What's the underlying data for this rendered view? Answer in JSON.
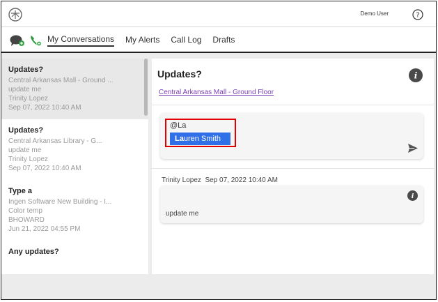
{
  "header": {
    "user_name": "Demo User"
  },
  "nav": {
    "tabs": [
      {
        "label": "My Conversations",
        "active": true
      },
      {
        "label": "My Alerts",
        "active": false
      },
      {
        "label": "Call Log",
        "active": false
      },
      {
        "label": "Drafts",
        "active": false
      }
    ]
  },
  "conversations": [
    {
      "title": "Updates?",
      "location": "Central Arkansas Mall - Ground ...",
      "message": "update me",
      "author": "Trinity Lopez",
      "date": "Sep 07, 2022 10:40 AM",
      "selected": true
    },
    {
      "title": "Updates?",
      "location": "Central Arkansas Library - G...",
      "message": "update me",
      "author": "Trinity Lopez",
      "date": "Sep 07, 2022 10:40 AM",
      "selected": false
    },
    {
      "title": "Type a",
      "location": "Ingen Software New Building - I...",
      "message": "Color temp",
      "author": "BHOWARD",
      "date": "Jun 21, 2022 04:55 PM",
      "selected": false
    },
    {
      "title": "Any updates?",
      "location": "",
      "message": "",
      "author": "",
      "date": "",
      "selected": false
    }
  ],
  "detail": {
    "title": "Updates?",
    "location_link": "Central Arkansas Mall - Ground Floor",
    "compose": {
      "text": "@La",
      "suggestion_match": "La",
      "suggestion_rest": "uren Smith"
    },
    "message": {
      "author": "Trinity Lopez",
      "date": "Sep 07, 2022 10:40 AM",
      "body": "update me"
    }
  },
  "colors": {
    "accent_link": "#7a3fb3",
    "highlight_box": "#e00000",
    "suggestion_bg": "#2f6fe8",
    "phone_icon": "#2e9a3e",
    "info_icon": "#4a4a4a"
  },
  "icons": [
    "logo-icon",
    "help-icon",
    "chat-icon",
    "phone-icon",
    "info-icon",
    "send-icon"
  ]
}
